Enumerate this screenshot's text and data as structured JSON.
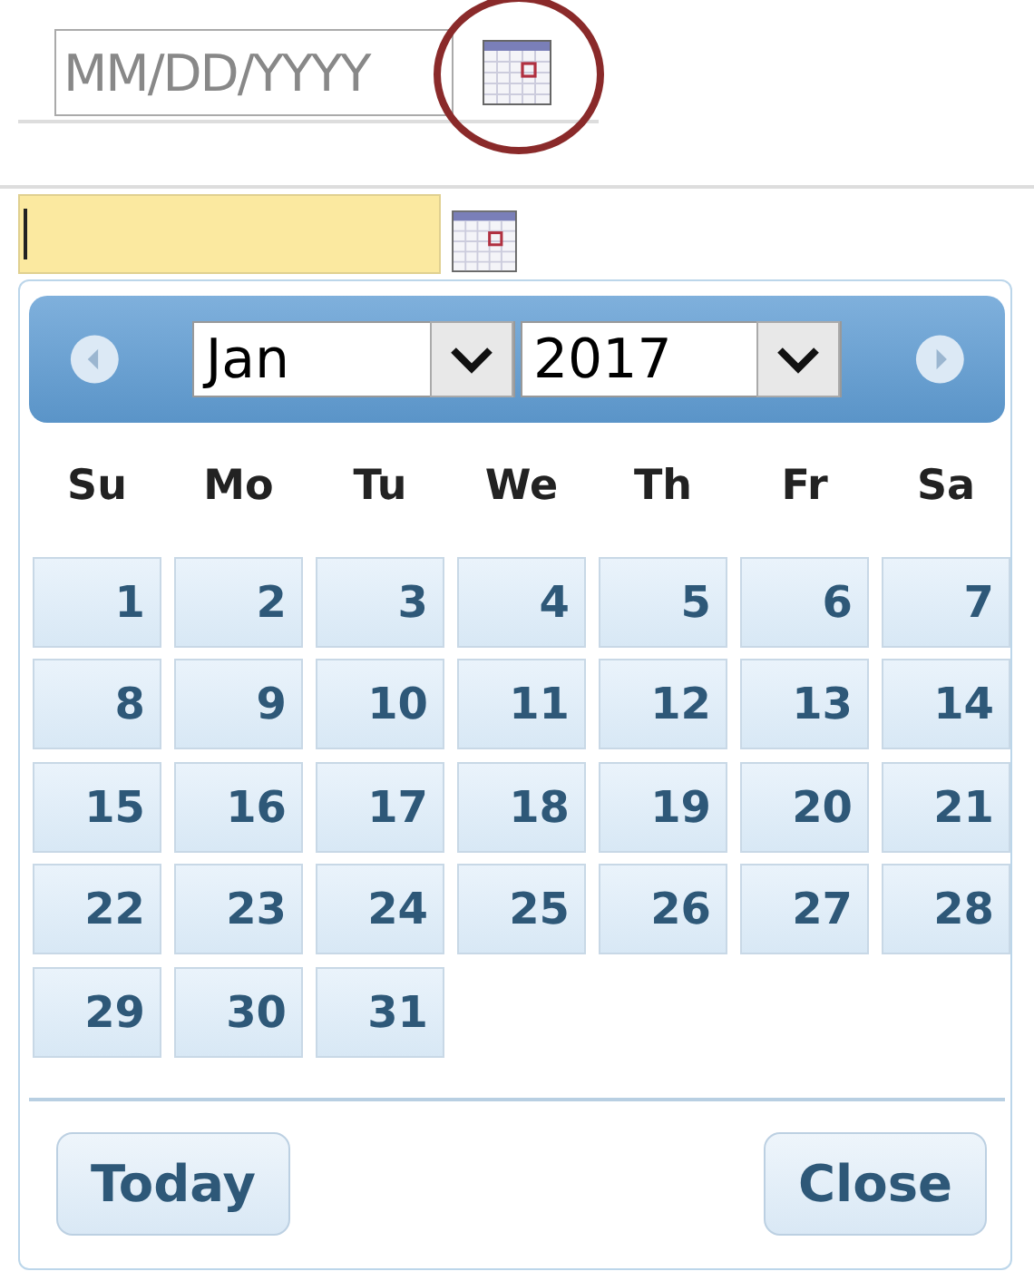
{
  "date_field": {
    "placeholder": "MM/DD/YYYY",
    "highlighted": true
  },
  "picker_field": {
    "focused": true
  },
  "datepicker": {
    "month": "Jan",
    "year": "2017",
    "weekdays": [
      "Su",
      "Mo",
      "Tu",
      "We",
      "Th",
      "Fr",
      "Sa"
    ],
    "weeks": [
      [
        "1",
        "2",
        "3",
        "4",
        "5",
        "6",
        "7"
      ],
      [
        "8",
        "9",
        "10",
        "11",
        "12",
        "13",
        "14"
      ],
      [
        "15",
        "16",
        "17",
        "18",
        "19",
        "20",
        "21"
      ],
      [
        "22",
        "23",
        "24",
        "25",
        "26",
        "27",
        "28"
      ],
      [
        "29",
        "30",
        "31"
      ]
    ],
    "buttons": [
      "Today",
      "Close"
    ]
  }
}
